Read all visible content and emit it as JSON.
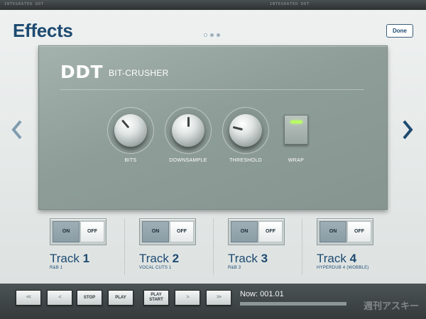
{
  "top_strip": {
    "left_text": "INTEGRATED DDT",
    "right_text": "INTEGRATED DDT"
  },
  "header": {
    "title": "Effects",
    "done_label": "Done",
    "page_count": 3,
    "active_page": 0
  },
  "nav": {
    "prev_icon": "chevron-left-icon",
    "next_icon": "chevron-right-icon"
  },
  "effect": {
    "brand": "DDT",
    "name": "BIT-CRUSHER",
    "knobs": [
      {
        "label": "BITS",
        "level": 0.35
      },
      {
        "label": "DOWNSAMPLE",
        "level": 0.5
      },
      {
        "label": "THRESHOLD",
        "level": 0.22
      }
    ],
    "wrap": {
      "label": "WRAP",
      "on": true
    }
  },
  "tracks": [
    {
      "word": "Track",
      "number": "1",
      "sub": "R&B 1",
      "on_label": "ON",
      "off_label": "OFF",
      "state": "on"
    },
    {
      "word": "Track",
      "number": "2",
      "sub": "VOCAL CUTS 1",
      "on_label": "ON",
      "off_label": "OFF",
      "state": "on"
    },
    {
      "word": "Track",
      "number": "3",
      "sub": "R&B 3",
      "on_label": "ON",
      "off_label": "OFF",
      "state": "on"
    },
    {
      "word": "Track",
      "number": "4",
      "sub": "HYPERDUB 4 (WOBBLE)",
      "on_label": "ON",
      "off_label": "OFF",
      "state": "on"
    }
  ],
  "transport": {
    "rewind_glyph": "<<",
    "back_glyph": "<",
    "stop_label": "STOP",
    "play_label": "PLAY",
    "play_start_line1": "PLAY",
    "play_start_line2": "START",
    "forward_glyph": ">",
    "fastforward_glyph": ">>",
    "now_text": "Now: 001.01",
    "progress": 0.0
  },
  "watermark": "週刊アスキー",
  "colors": {
    "accent": "#1d4a70",
    "panel": "#95a49f",
    "led": "#b6ff5e"
  }
}
